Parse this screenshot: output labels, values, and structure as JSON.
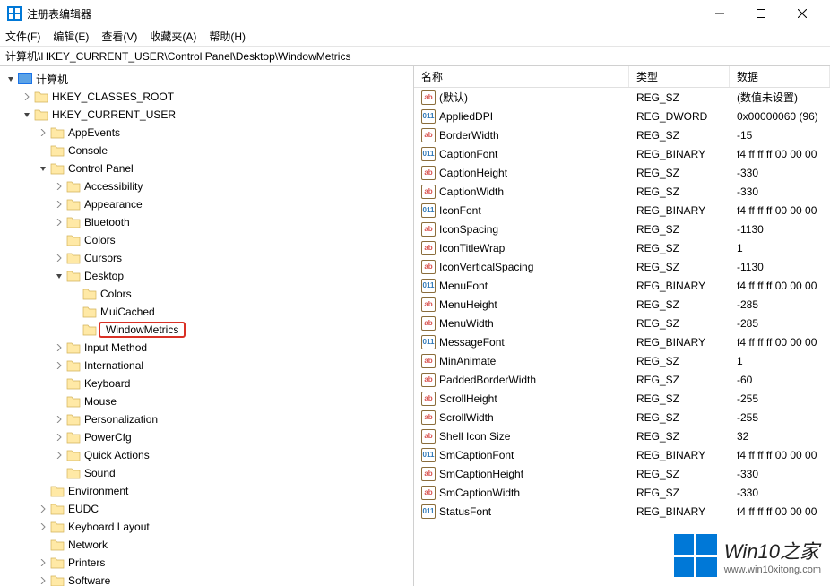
{
  "window": {
    "title": "注册表编辑器"
  },
  "menu": {
    "file": "文件(F)",
    "edit": "编辑(E)",
    "view": "查看(V)",
    "favorites": "收藏夹(A)",
    "help": "帮助(H)"
  },
  "addressbar": "计算机\\HKEY_CURRENT_USER\\Control Panel\\Desktop\\WindowMetrics",
  "tree": [
    {
      "depth": 0,
      "expand": "expanded",
      "icon": "computer",
      "label": "计算机"
    },
    {
      "depth": 1,
      "expand": "collapsed",
      "icon": "folder",
      "label": "HKEY_CLASSES_ROOT"
    },
    {
      "depth": 1,
      "expand": "expanded",
      "icon": "folder",
      "label": "HKEY_CURRENT_USER"
    },
    {
      "depth": 2,
      "expand": "collapsed",
      "icon": "folder",
      "label": "AppEvents"
    },
    {
      "depth": 2,
      "expand": "none",
      "icon": "folder",
      "label": "Console"
    },
    {
      "depth": 2,
      "expand": "expanded",
      "icon": "folder",
      "label": "Control Panel"
    },
    {
      "depth": 3,
      "expand": "collapsed",
      "icon": "folder",
      "label": "Accessibility"
    },
    {
      "depth": 3,
      "expand": "collapsed",
      "icon": "folder",
      "label": "Appearance"
    },
    {
      "depth": 3,
      "expand": "collapsed",
      "icon": "folder",
      "label": "Bluetooth"
    },
    {
      "depth": 3,
      "expand": "none",
      "icon": "folder",
      "label": "Colors"
    },
    {
      "depth": 3,
      "expand": "collapsed",
      "icon": "folder",
      "label": "Cursors"
    },
    {
      "depth": 3,
      "expand": "expanded",
      "icon": "folder",
      "label": "Desktop"
    },
    {
      "depth": 4,
      "expand": "none",
      "icon": "folder",
      "label": "Colors"
    },
    {
      "depth": 4,
      "expand": "none",
      "icon": "folder",
      "label": "MuiCached"
    },
    {
      "depth": 4,
      "expand": "none",
      "icon": "folder",
      "label": "WindowMetrics",
      "highlight": true
    },
    {
      "depth": 3,
      "expand": "collapsed",
      "icon": "folder",
      "label": "Input Method"
    },
    {
      "depth": 3,
      "expand": "collapsed",
      "icon": "folder",
      "label": "International"
    },
    {
      "depth": 3,
      "expand": "none",
      "icon": "folder",
      "label": "Keyboard"
    },
    {
      "depth": 3,
      "expand": "none",
      "icon": "folder",
      "label": "Mouse"
    },
    {
      "depth": 3,
      "expand": "collapsed",
      "icon": "folder",
      "label": "Personalization"
    },
    {
      "depth": 3,
      "expand": "collapsed",
      "icon": "folder",
      "label": "PowerCfg"
    },
    {
      "depth": 3,
      "expand": "collapsed",
      "icon": "folder",
      "label": "Quick Actions"
    },
    {
      "depth": 3,
      "expand": "none",
      "icon": "folder",
      "label": "Sound"
    },
    {
      "depth": 2,
      "expand": "none",
      "icon": "folder",
      "label": "Environment"
    },
    {
      "depth": 2,
      "expand": "collapsed",
      "icon": "folder",
      "label": "EUDC"
    },
    {
      "depth": 2,
      "expand": "collapsed",
      "icon": "folder",
      "label": "Keyboard Layout"
    },
    {
      "depth": 2,
      "expand": "none",
      "icon": "folder",
      "label": "Network"
    },
    {
      "depth": 2,
      "expand": "collapsed",
      "icon": "folder",
      "label": "Printers"
    },
    {
      "depth": 2,
      "expand": "collapsed",
      "icon": "folder",
      "label": "Software"
    }
  ],
  "columns": {
    "name": "名称",
    "type": "类型",
    "data": "数据"
  },
  "values": [
    {
      "icon": "str",
      "name": "(默认)",
      "type": "REG_SZ",
      "data": "(数值未设置)"
    },
    {
      "icon": "bin",
      "name": "AppliedDPI",
      "type": "REG_DWORD",
      "data": "0x00000060 (96)"
    },
    {
      "icon": "str",
      "name": "BorderWidth",
      "type": "REG_SZ",
      "data": "-15"
    },
    {
      "icon": "bin",
      "name": "CaptionFont",
      "type": "REG_BINARY",
      "data": "f4 ff ff ff 00 00 00"
    },
    {
      "icon": "str",
      "name": "CaptionHeight",
      "type": "REG_SZ",
      "data": "-330"
    },
    {
      "icon": "str",
      "name": "CaptionWidth",
      "type": "REG_SZ",
      "data": "-330"
    },
    {
      "icon": "bin",
      "name": "IconFont",
      "type": "REG_BINARY",
      "data": "f4 ff ff ff 00 00 00"
    },
    {
      "icon": "str",
      "name": "IconSpacing",
      "type": "REG_SZ",
      "data": "-1130"
    },
    {
      "icon": "str",
      "name": "IconTitleWrap",
      "type": "REG_SZ",
      "data": "1"
    },
    {
      "icon": "str",
      "name": "IconVerticalSpacing",
      "type": "REG_SZ",
      "data": "-1130"
    },
    {
      "icon": "bin",
      "name": "MenuFont",
      "type": "REG_BINARY",
      "data": "f4 ff ff ff 00 00 00"
    },
    {
      "icon": "str",
      "name": "MenuHeight",
      "type": "REG_SZ",
      "data": "-285"
    },
    {
      "icon": "str",
      "name": "MenuWidth",
      "type": "REG_SZ",
      "data": "-285"
    },
    {
      "icon": "bin",
      "name": "MessageFont",
      "type": "REG_BINARY",
      "data": "f4 ff ff ff 00 00 00"
    },
    {
      "icon": "str",
      "name": "MinAnimate",
      "type": "REG_SZ",
      "data": "1"
    },
    {
      "icon": "str",
      "name": "PaddedBorderWidth",
      "type": "REG_SZ",
      "data": "-60"
    },
    {
      "icon": "str",
      "name": "ScrollHeight",
      "type": "REG_SZ",
      "data": "-255"
    },
    {
      "icon": "str",
      "name": "ScrollWidth",
      "type": "REG_SZ",
      "data": "-255"
    },
    {
      "icon": "str",
      "name": "Shell Icon Size",
      "type": "REG_SZ",
      "data": "32"
    },
    {
      "icon": "bin",
      "name": "SmCaptionFont",
      "type": "REG_BINARY",
      "data": "f4 ff ff ff 00 00 00"
    },
    {
      "icon": "str",
      "name": "SmCaptionHeight",
      "type": "REG_SZ",
      "data": "-330"
    },
    {
      "icon": "str",
      "name": "SmCaptionWidth",
      "type": "REG_SZ",
      "data": "-330"
    },
    {
      "icon": "bin",
      "name": "StatusFont",
      "type": "REG_BINARY",
      "data": "f4 ff ff ff 00 00 00"
    }
  ],
  "watermark": {
    "title": "Win10之家",
    "url": "www.win10xitong.com"
  }
}
